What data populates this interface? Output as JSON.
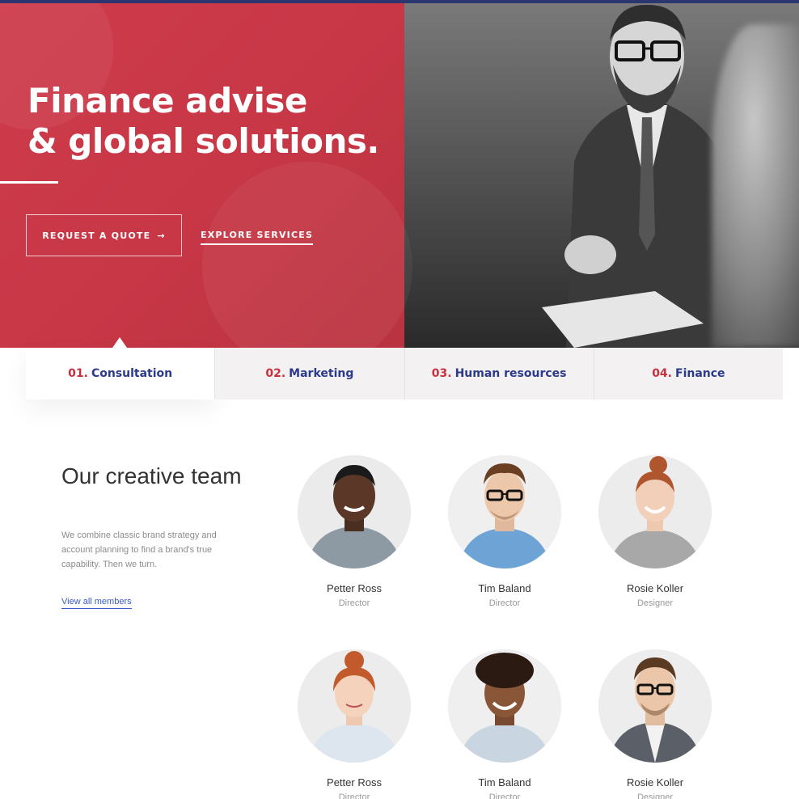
{
  "hero": {
    "title": "Finance advise\n& global solutions.",
    "quote_button": "REQUEST A QUOTE",
    "quote_arrow": "→",
    "explore_link": "EXPLORE SERVICES",
    "accent_color": "#c8303f"
  },
  "tabs": [
    {
      "num": "01.",
      "label": "Consultation",
      "active": true
    },
    {
      "num": "02.",
      "label": "Marketing",
      "active": false
    },
    {
      "num": "03.",
      "label": "Human resources",
      "active": false
    },
    {
      "num": "04.",
      "label": "Finance",
      "active": false
    }
  ],
  "team": {
    "title": "Our creative team",
    "description": "We combine classic brand strategy and account planning to find a brand's true capability. Then we turn.",
    "link": "View all members",
    "members": [
      {
        "name": "Petter Ross",
        "role": "Director"
      },
      {
        "name": "Tim Baland",
        "role": "Director"
      },
      {
        "name": "Rosie Koller",
        "role": "Designer"
      },
      {
        "name": "Petter Ross",
        "role": "Director"
      },
      {
        "name": "Tim Baland",
        "role": "Director"
      },
      {
        "name": "Rosie Koller",
        "role": "Designer"
      }
    ]
  }
}
